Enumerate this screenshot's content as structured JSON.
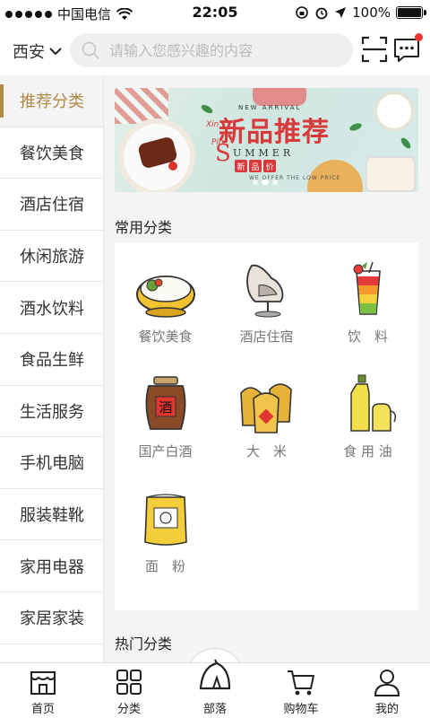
{
  "status_bar": {
    "carrier": "中国电信",
    "time": "22:05",
    "battery": "100%",
    "battery_level": 1.0
  },
  "header": {
    "city": "西安",
    "search_placeholder": "请输入您感兴趣的内容",
    "has_unread_message": true
  },
  "sidebar": {
    "items": [
      {
        "label": "推荐分类",
        "active": true
      },
      {
        "label": "餐饮美食",
        "active": false
      },
      {
        "label": "酒店住宿",
        "active": false
      },
      {
        "label": "休闲旅游",
        "active": false
      },
      {
        "label": "酒水饮料",
        "active": false
      },
      {
        "label": "食品生鲜",
        "active": false
      },
      {
        "label": "生活服务",
        "active": false
      },
      {
        "label": "手机电脑",
        "active": false
      },
      {
        "label": "服装鞋靴",
        "active": false
      },
      {
        "label": "家用电器",
        "active": false
      },
      {
        "label": "家居家装",
        "active": false
      }
    ]
  },
  "banner": {
    "title": "新品推荐",
    "new_arrival": "NEW ARRIVAL",
    "xin": "Xin",
    "pin": "Pin",
    "summer_s": "S",
    "summer": "UMMER",
    "stamp": [
      "新",
      "品",
      "价"
    ],
    "subtext": "WE OFFER THE LOW PRICE",
    "slide_count": 3,
    "active_slide": 2
  },
  "common_section": {
    "title": "常用分类",
    "items": [
      {
        "label": "餐饮美食",
        "icon": "rice-bowl-icon"
      },
      {
        "label": "酒店住宿",
        "icon": "egg-chair-icon"
      },
      {
        "label": "饮　料",
        "icon": "layered-drink-icon"
      },
      {
        "label": "国产白酒",
        "icon": "liquor-jar-icon"
      },
      {
        "label": "大　米",
        "icon": "rice-sack-icon"
      },
      {
        "label": "食 用 油",
        "icon": "oil-bottle-icon"
      },
      {
        "label": "面　粉",
        "icon": "flour-bag-icon"
      }
    ]
  },
  "hot_section": {
    "title": "热门分类"
  },
  "tabbar": {
    "items": [
      {
        "label": "首页",
        "icon": "shop-icon"
      },
      {
        "label": "分类",
        "icon": "grid-icon"
      },
      {
        "label": "部落",
        "icon": "tent-icon"
      },
      {
        "label": "购物车",
        "icon": "cart-icon"
      },
      {
        "label": "我的",
        "icon": "user-icon"
      }
    ]
  },
  "colors": {
    "accent": "#b08a46",
    "banner_red": "#d8393a",
    "badge_red": "#e33333"
  }
}
